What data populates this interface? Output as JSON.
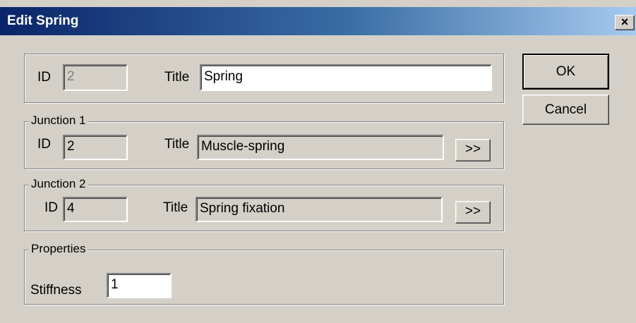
{
  "window": {
    "title": "Edit Spring",
    "close_glyph": "×"
  },
  "main": {
    "id_label": "ID",
    "id_value": "2",
    "title_label": "Title",
    "title_value": "Spring"
  },
  "junction1": {
    "group_label": "Junction 1",
    "id_label": "ID",
    "id_value": "2",
    "title_label": "Title",
    "title_value": "Muscle-spring",
    "browse_label": ">>"
  },
  "junction2": {
    "group_label": "Junction 2",
    "id_label": "ID",
    "id_value": "4",
    "title_label": "Title",
    "title_value": "Spring fixation",
    "browse_label": ">>"
  },
  "properties": {
    "group_label": "Properties",
    "stiffness_label": "Stiffness",
    "stiffness_value": "1"
  },
  "buttons": {
    "ok_label": "OK",
    "cancel_label": "Cancel"
  }
}
